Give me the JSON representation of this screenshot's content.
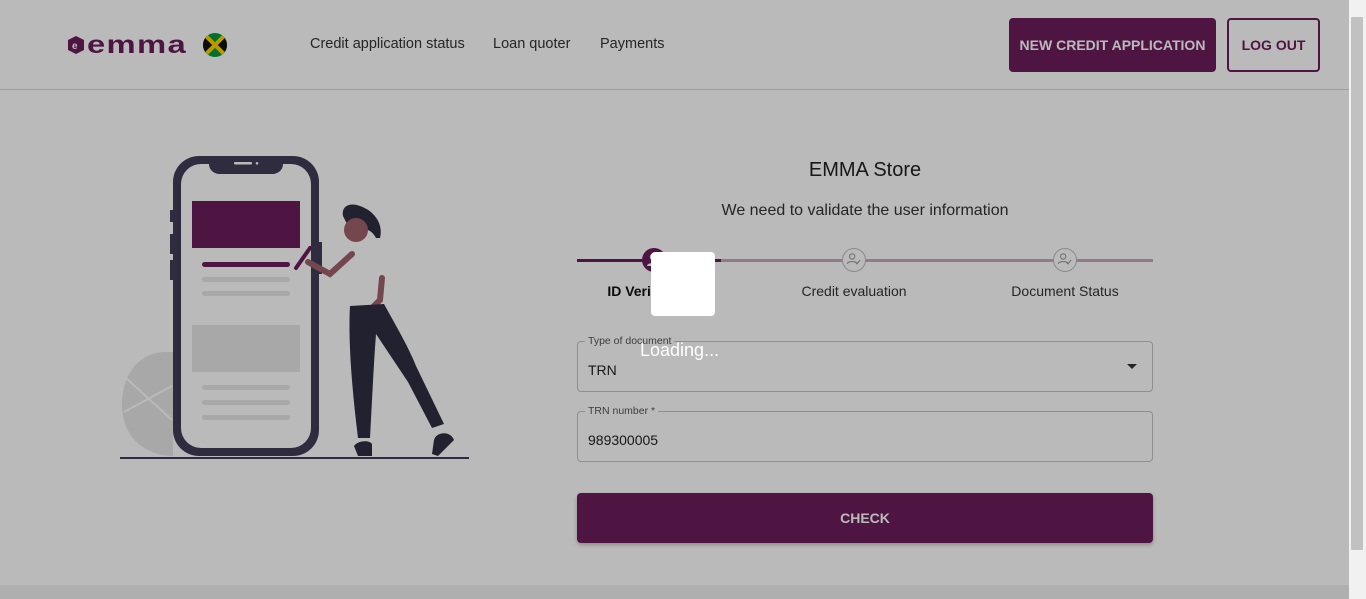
{
  "header": {
    "logo_text": "emma",
    "nav": [
      "Credit application status",
      "Loan quoter",
      "Payments"
    ],
    "new_credit_label": "NEW CREDIT APPLICATION",
    "logout_label": "LOG OUT"
  },
  "main": {
    "store_name": "EMMA Store",
    "subtitle": "We need to validate the user information",
    "steps": [
      {
        "label": "ID Verification",
        "status": "active"
      },
      {
        "label": "Credit evaluation",
        "status": "pending"
      },
      {
        "label": "Document Status",
        "status": "pending"
      }
    ],
    "document_type": {
      "label": "Type of document",
      "value": "TRN"
    },
    "trn_number": {
      "label": "TRN number *",
      "value": "989300005"
    },
    "check_label": "CHECK"
  },
  "overlay": {
    "loading_text": "Loading..."
  },
  "colors": {
    "brand": "#6b1d5c",
    "step_pending": "#c8a6c1"
  },
  "icons": {
    "flag": "jamaica-flag-icon",
    "step": "user-check-icon",
    "dropdown": "arrow-drop-down-icon"
  }
}
